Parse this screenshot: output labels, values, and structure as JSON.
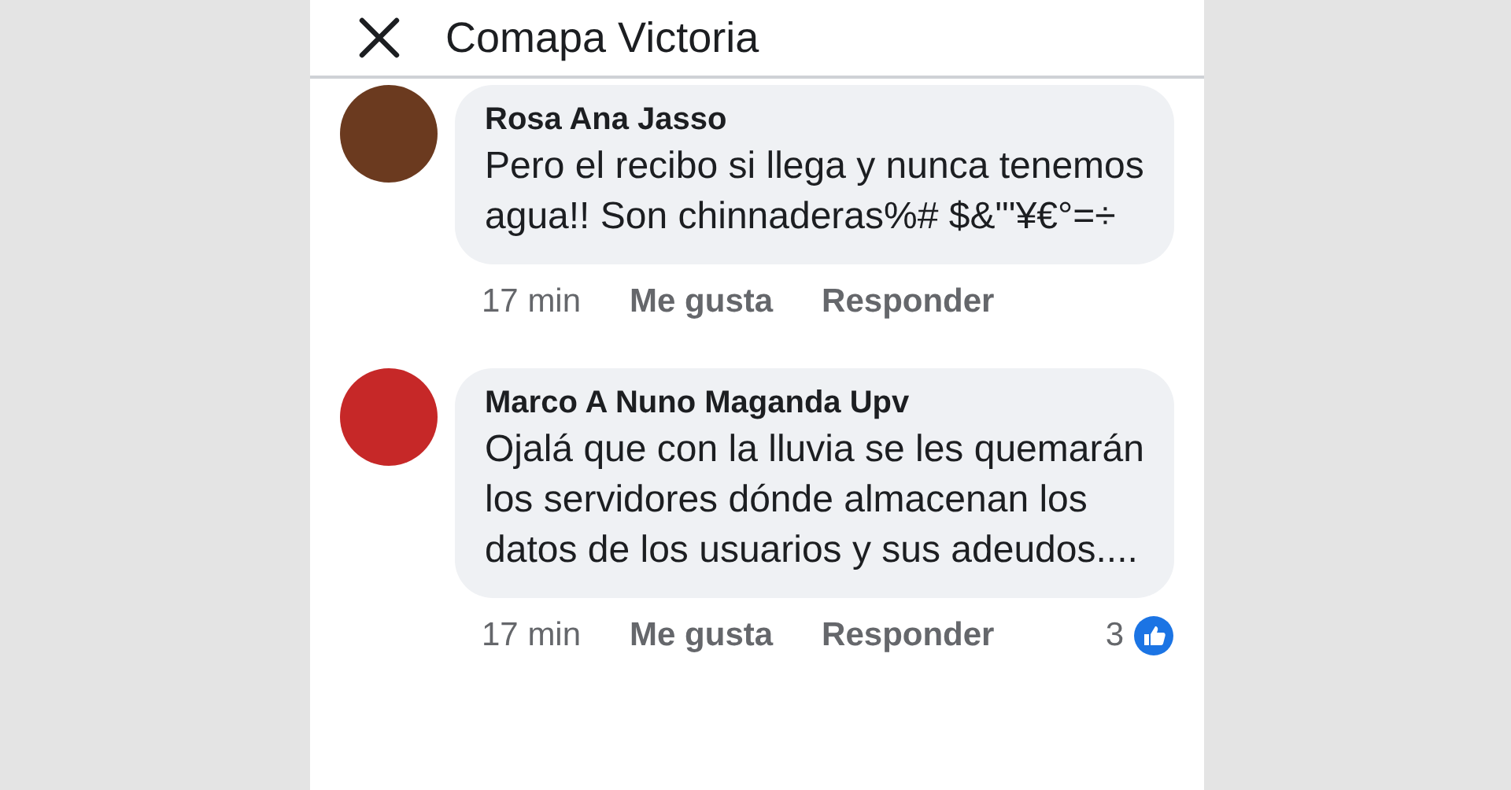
{
  "header": {
    "title": "Comapa Victoria"
  },
  "comments": [
    {
      "author": "Rosa Ana Jasso",
      "text": "Pero el recibo si llega y nunca tenemos agua!! Son chinnaderas%# $&\"'¥€°=÷",
      "time": "17 min",
      "like": "Me gusta",
      "reply": "Responder"
    },
    {
      "author": "Marco A Nuno Maganda Upv",
      "text": "Ojalá que con la lluvia se les quemarán los servidores dónde almacenan los datos de los usuarios y sus adeudos....",
      "time": "17 min",
      "like": "Me gusta",
      "reply": "Responder",
      "reactions": "3"
    }
  ]
}
